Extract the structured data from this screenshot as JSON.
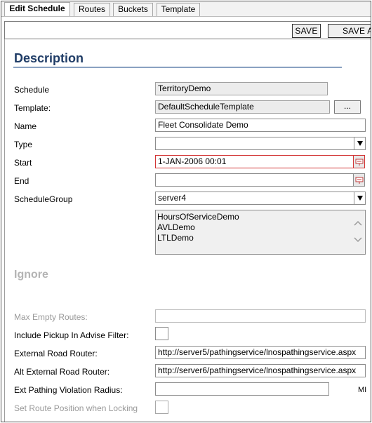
{
  "tabs": [
    {
      "label": "Edit Schedule",
      "active": true
    },
    {
      "label": "Routes",
      "active": false
    },
    {
      "label": "Buckets",
      "active": false
    },
    {
      "label": "Template",
      "active": false
    }
  ],
  "toolbar": {
    "save_label": "SAVE",
    "save_as_label": "SAVE A"
  },
  "description": {
    "title": "Description",
    "schedule_label": "Schedule",
    "schedule_value": "TerritoryDemo",
    "template_label": "Template:",
    "template_value": "DefaultScheduleTemplate",
    "template_button": "...",
    "name_label": "Name",
    "name_value": "Fleet Consolidate Demo",
    "type_label": "Type",
    "type_value": "",
    "start_label": "Start",
    "start_value": "1-JAN-2006 00:01",
    "end_label": "End",
    "end_value": "",
    "schedule_group_label": "ScheduleGroup",
    "schedule_group_value": "server4",
    "schedule_group_list": [
      "HoursOfServiceDemo",
      "AVLDemo",
      "LTLDemo"
    ]
  },
  "ignore": {
    "title": "Ignore",
    "max_empty_routes_label": "Max Empty Routes:",
    "max_empty_routes_value": "",
    "include_pickup_label": "Include Pickup In Advise Filter:",
    "include_pickup_checked": false,
    "external_router_label": "External Road Router:",
    "external_router_value": "http://server5/pathingservice/lnospathingservice.aspx",
    "alt_router_label": "Alt External Road Router:",
    "alt_router_value": "http://server6/pathingservice/lnospathingservice.aspx",
    "ext_violation_label": "Ext Pathing Violation Radius:",
    "ext_violation_value": "",
    "ext_violation_unit": "MI",
    "set_route_position_label": "Set Route Position when Locking",
    "set_route_position_checked": false
  },
  "colors": {
    "title_blue": "#1f3c66",
    "error_border": "#d23434"
  }
}
